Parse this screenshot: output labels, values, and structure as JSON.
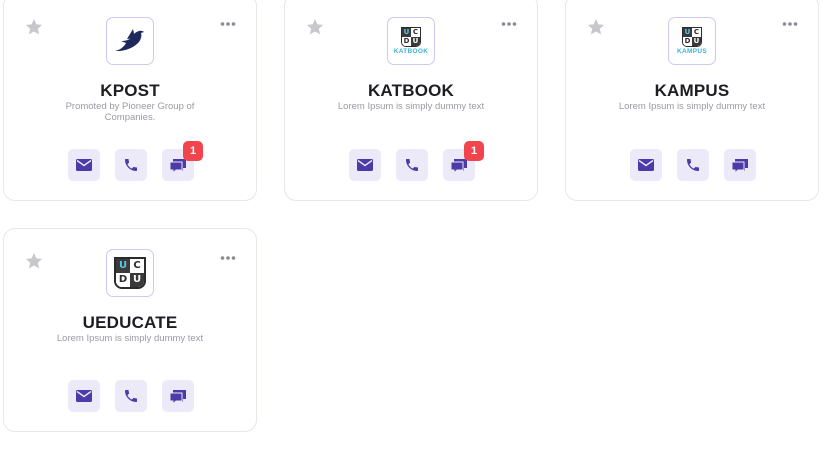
{
  "colors": {
    "accent": "#4b3aa8",
    "action_bg": "#eceaf8",
    "badge": "#f2444d",
    "star": "#c8c8cc"
  },
  "cards": [
    {
      "title": "KPOST",
      "subtitle": "Promoted by Pioneer Group of Companies.",
      "logo": "bird-logo",
      "chat_badge": "1"
    },
    {
      "title": "KATBOOK",
      "subtitle": "Lorem Ipsum is simply dummy text",
      "logo": "katbook-logo",
      "logo_text": "KATBOOK",
      "chat_badge": "1"
    },
    {
      "title": "KAMPUS",
      "subtitle": "Lorem Ipsum is simply dummy text",
      "logo": "kampus-logo",
      "logo_text": "KAMPUS"
    },
    {
      "title": "UEDUCATE",
      "subtitle": "Lorem Ipsum is simply dummy text",
      "logo": "ueducate-logo"
    }
  ],
  "ucdu_letters": [
    "U",
    "C",
    "D",
    "U"
  ],
  "icons": [
    "star-icon",
    "more-icon",
    "mail-icon",
    "phone-icon",
    "chat-icon"
  ]
}
